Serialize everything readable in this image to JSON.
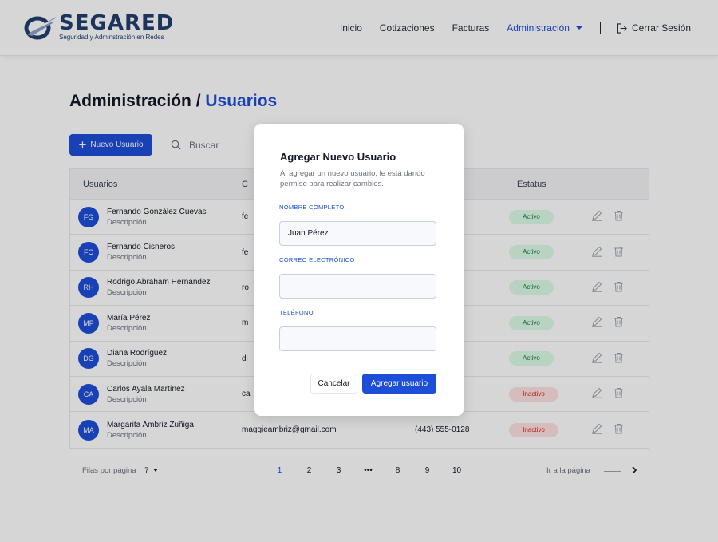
{
  "brand": {
    "name": "SEGARED",
    "tagline": "Seguridad y Adminstración en Redes"
  },
  "nav": {
    "items": [
      "Inicio",
      "Cotizaciones",
      "Facturas"
    ],
    "active": "Administración",
    "logout": "Cerrar Sesión"
  },
  "page": {
    "title_prefix": "Administración / ",
    "title_highlight": "Usuarios"
  },
  "toolbar": {
    "new_user": "Nuevo Usuario",
    "search_placeholder": "Buscar"
  },
  "table": {
    "headers": [
      "Usuarios",
      "C",
      "",
      "Estatus"
    ],
    "rows": [
      {
        "initials": "FG",
        "name": "Fernando González Cuevas",
        "desc": "Descripción",
        "email": "fe",
        "phone": ")0102",
        "status": "Activo",
        "active": true
      },
      {
        "initials": "FC",
        "name": "Fernando Cisneros",
        "desc": "Descripción",
        "email": "fe",
        "phone": ")0125",
        "status": "Activo",
        "active": true
      },
      {
        "initials": "RH",
        "name": "Rodrigo Abraham Hernández",
        "desc": "Descripción",
        "email": "ro",
        "phone": ")0123",
        "status": "Activo",
        "active": true
      },
      {
        "initials": "MP",
        "name": "María Pérez",
        "desc": "Descripción",
        "email": "m",
        "phone": ")0124",
        "status": "Activo",
        "active": true
      },
      {
        "initials": "DG",
        "name": "Diana Rodríguez",
        "desc": "Descripción",
        "email": "di",
        "phone": ")0127",
        "status": "Activo",
        "active": true
      },
      {
        "initials": "CA",
        "name": "Carlos Ayala Martínez",
        "desc": "Descripción",
        "email": "ca",
        "phone": ")0113",
        "status": "Inactivo",
        "active": false
      },
      {
        "initials": "MA",
        "name": "Margarita Ambriz Zuñiga",
        "desc": "Descripción",
        "email": "maggieambriz@gmail.com",
        "phone": "(443) 555-0128",
        "status": "Inactivo",
        "active": false
      }
    ]
  },
  "pagination": {
    "rows_label": "Filas por página",
    "rows_value": "7",
    "pages": [
      "1",
      "2",
      "3",
      "•••",
      "8",
      "9",
      "10"
    ],
    "current": "1",
    "goto_label": "Ir a la página"
  },
  "modal": {
    "title": "Agregar Nuevo Usuario",
    "subtitle": "Al agregar un nuevo usuario, le está dando permiso para realizar cambios.",
    "name_label": "NOMBRE COMPLETO",
    "name_value": "Juan Pérez",
    "email_label": "CORREO ELECTRÓNICO",
    "email_value": "",
    "phone_label": "TELÉFONO",
    "phone_value": "",
    "cancel": "Cancelar",
    "submit": "Agregar usuario"
  },
  "colors": {
    "primary": "#1d4ed8",
    "brand": "#1f3f6e",
    "active_bg": "#dcfce7",
    "inactive_bg": "#fee2e2"
  }
}
